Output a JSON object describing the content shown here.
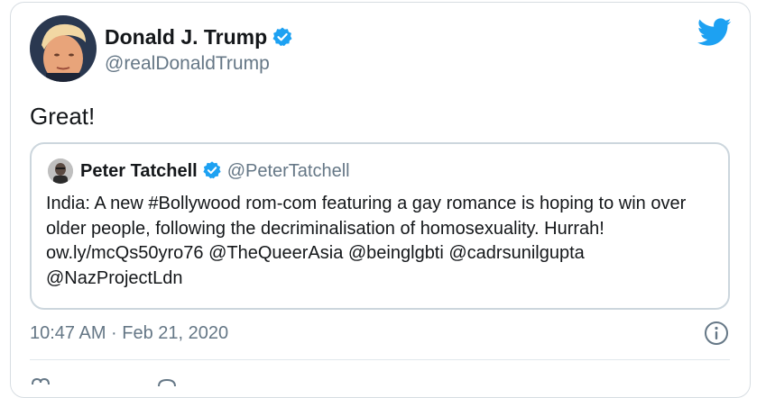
{
  "tweet": {
    "author_name": "Donald J. Trump",
    "author_handle": "@realDonaldTrump",
    "text": "Great!",
    "timestamp": "10:47 AM · Feb 21, 2020"
  },
  "quoted_tweet": {
    "author_name": "Peter Tatchell",
    "author_handle": "@PeterTatchell",
    "text": "India: A new #Bollywood rom-com featuring a gay romance is hoping to win over older people, following the decriminalisation of homosexuality. Hurrah! ow.ly/mcQs50yro76 @TheQueerAsia @beinglgbti @cadrsunilgupta @NazProjectLdn"
  },
  "icons": {
    "verified": "verified-badge-icon",
    "brand": "twitter-bird-icon",
    "info": "info-icon"
  },
  "colors": {
    "brand_blue": "#1da1f2",
    "secondary_text": "#657786",
    "border": "#ccd6dd"
  }
}
